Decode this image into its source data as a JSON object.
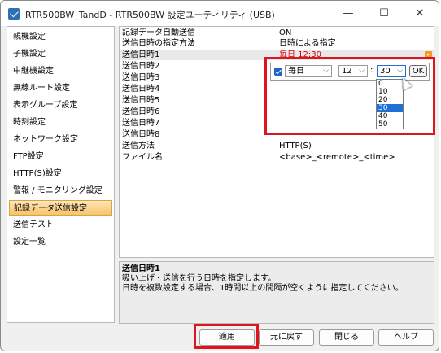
{
  "window": {
    "title": "RTR500BW_TandD - RTR500BW 設定ユーティリティ (USB)",
    "controls": {
      "minimize": "—",
      "maximize": "☐",
      "close": "✕"
    }
  },
  "sidebar": {
    "items": [
      {
        "label": "親機設定"
      },
      {
        "label": "子機設定"
      },
      {
        "label": "中継機設定"
      },
      {
        "label": "無線ルート設定"
      },
      {
        "label": "表示グループ設定"
      },
      {
        "label": "時刻設定"
      },
      {
        "label": "ネットワーク設定"
      },
      {
        "label": "FTP設定"
      },
      {
        "label": "HTTP(S)設定"
      },
      {
        "label": "警報 / モニタリング設定"
      },
      {
        "label": "記録データ送信設定",
        "selected": true
      },
      {
        "label": "送信テスト"
      },
      {
        "label": "設定一覧"
      }
    ]
  },
  "grid": {
    "rows": [
      {
        "label": "記録データ自動送信",
        "value": "ON"
      },
      {
        "label": "送信日時の指定方法",
        "value": "日時による指定"
      },
      {
        "label": "送信日時1",
        "value": "毎日  12:30"
      },
      {
        "label": "送信日時2",
        "value": ""
      },
      {
        "label": "送信日時3",
        "value": ""
      },
      {
        "label": "送信日時4",
        "value": ""
      },
      {
        "label": "送信日時5",
        "value": ""
      },
      {
        "label": "送信日時6",
        "value": ""
      },
      {
        "label": "送信日時7",
        "value": ""
      },
      {
        "label": "送信日時8",
        "value": ""
      },
      {
        "label": "送信方法",
        "value": "HTTP(S)"
      },
      {
        "label": "ファイル名",
        "value": "<base>_<remote>_<time>"
      }
    ]
  },
  "editor": {
    "enabled": true,
    "frequency": "毎日",
    "hour": "12",
    "colon": ":",
    "minute": "30",
    "ok_label": "OK",
    "minute_options": [
      "0",
      "10",
      "20",
      "30",
      "40",
      "50"
    ],
    "selected_minute": "30",
    "chevron": "⌵"
  },
  "description": {
    "title": "送信日時1",
    "line1": "吸い上げ・送信を行う日時を指定します。",
    "line2": "日時を複数設定する場合、1時間以上の間隔が空くように指定してください。"
  },
  "buttons": {
    "apply": "適用",
    "revert": "元に戻す",
    "close": "閉じる",
    "help": "ヘルプ"
  },
  "colors": {
    "highlight_red": "#e0141e",
    "selection_blue": "#1e70d6",
    "nav_selected": "#f7c46c"
  }
}
